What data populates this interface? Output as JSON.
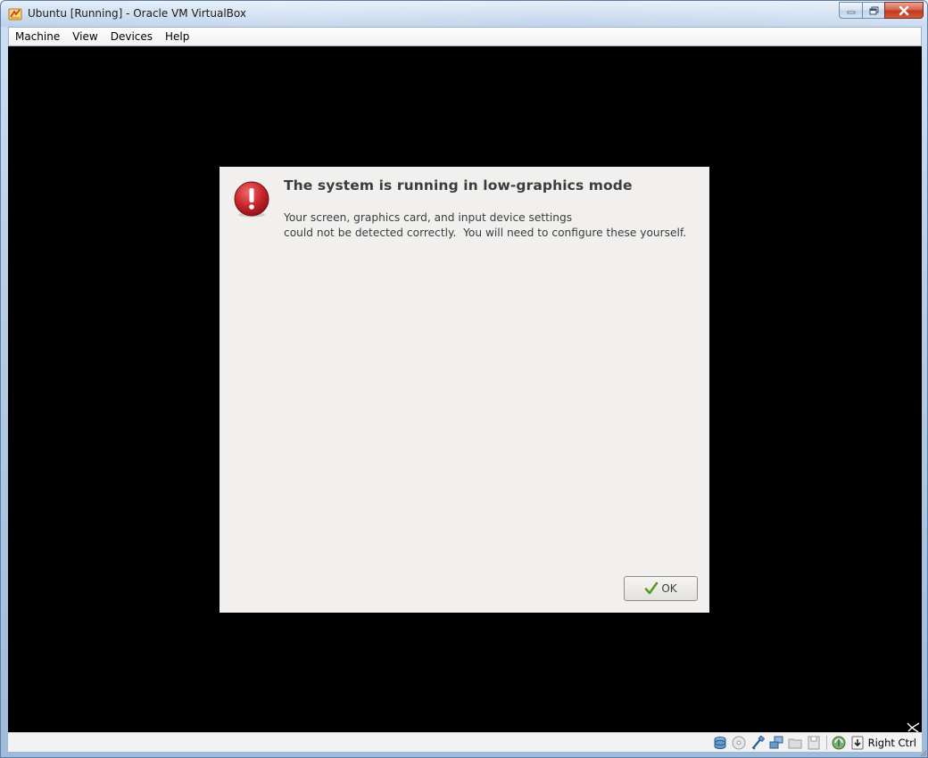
{
  "window": {
    "title": "Ubuntu [Running] - Oracle VM VirtualBox",
    "controls": {
      "minimize_icon": "minimize-icon",
      "maximize_icon": "restore-icon",
      "close_icon": "close-icon"
    }
  },
  "menubar": {
    "items": [
      {
        "label": "Machine"
      },
      {
        "label": "View"
      },
      {
        "label": "Devices"
      },
      {
        "label": "Help"
      }
    ]
  },
  "dialog": {
    "icon": "error-icon",
    "title": "The system is running in low-graphics mode",
    "message_line1": "Your screen, graphics card, and input device settings",
    "message_line2": "could not be detected correctly.  You will need to configure these yourself.",
    "ok_label": "OK",
    "ok_icon": "checkmark-icon"
  },
  "statusbar": {
    "icons": [
      "hard-disk-icon",
      "optical-drive-icon",
      "usb-icon",
      "network-icon",
      "shared-folders-icon",
      "floppy-icon",
      "virtualization-icon",
      "mouse-integration-icon"
    ],
    "host_key": "Right Ctrl"
  },
  "colors": {
    "vm_background": "#000000",
    "dialog_background": "#f1f0ee",
    "error_red": "#c8252b",
    "ok_check": "#5a9a1e"
  }
}
